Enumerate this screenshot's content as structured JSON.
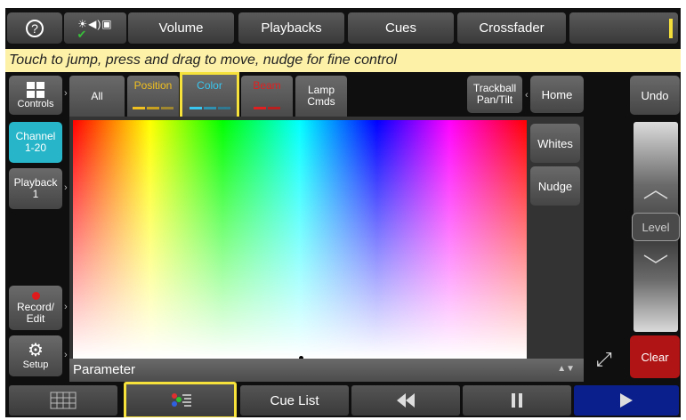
{
  "topbar": {
    "help": "?",
    "tabs": [
      "Volume",
      "Playbacks",
      "Cues",
      "Crossfader"
    ]
  },
  "hint": "Touch to jump, press and drag to move, nudge for fine control",
  "sidebar": {
    "controls": "Controls",
    "channel": [
      "Channel",
      "1-20"
    ],
    "playback": [
      "Playback",
      "1"
    ],
    "record": [
      "Record/",
      "Edit"
    ],
    "setup": "Setup"
  },
  "attr_tabs": {
    "all": "All",
    "position": "Position",
    "color": "Color",
    "beam": "Beam",
    "lamp": [
      "Lamp",
      "Cmds"
    ],
    "trackball": [
      "Trackball",
      "Pan/Tilt"
    ],
    "home": "Home"
  },
  "colors": {
    "position": "#f0c020",
    "color": "#39c6f0",
    "beam": "#e02020",
    "channel_bg": "#27b6c9",
    "clear_bg": "#b01414",
    "play_bg": "#0b1f8c"
  },
  "right_panel": {
    "whites": "Whites",
    "nudge": "Nudge",
    "undo": "Undo",
    "level": "Level",
    "clear": "Clear"
  },
  "picker": {
    "parameter": "Parameter"
  },
  "bottom": {
    "cue_list": "Cue List"
  },
  "icons": [
    "help-icon",
    "output-status-icons",
    "grid-icon",
    "gear-icon",
    "record-dot-icon",
    "color-palette-icon",
    "rewind-icon",
    "pause-icon",
    "play-icon",
    "zoom-fit-icon",
    "sort-arrows-icon"
  ]
}
